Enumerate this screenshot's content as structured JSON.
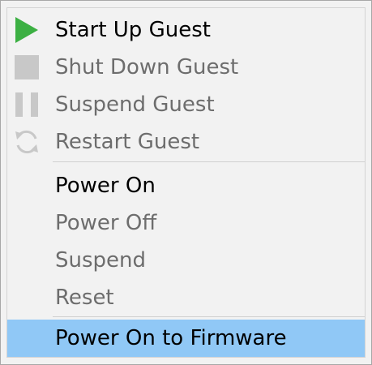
{
  "menu": {
    "guest_items": [
      {
        "label": "Start Up Guest",
        "icon": "play-icon",
        "enabled": true
      },
      {
        "label": "Shut Down Guest",
        "icon": "stop-icon",
        "enabled": false
      },
      {
        "label": "Suspend Guest",
        "icon": "pause-icon",
        "enabled": false
      },
      {
        "label": "Restart Guest",
        "icon": "restart-icon",
        "enabled": false
      }
    ],
    "power_items": [
      {
        "label": "Power On",
        "enabled": true
      },
      {
        "label": "Power Off",
        "enabled": false
      },
      {
        "label": "Suspend",
        "enabled": false
      },
      {
        "label": "Reset",
        "enabled": false
      }
    ],
    "firmware_item": {
      "label": "Power On to Firmware",
      "enabled": true,
      "highlighted": true
    }
  },
  "colors": {
    "play_green": "#3cb043",
    "disabled_icon": "#c8c8c8",
    "highlight": "#90c8f6"
  }
}
